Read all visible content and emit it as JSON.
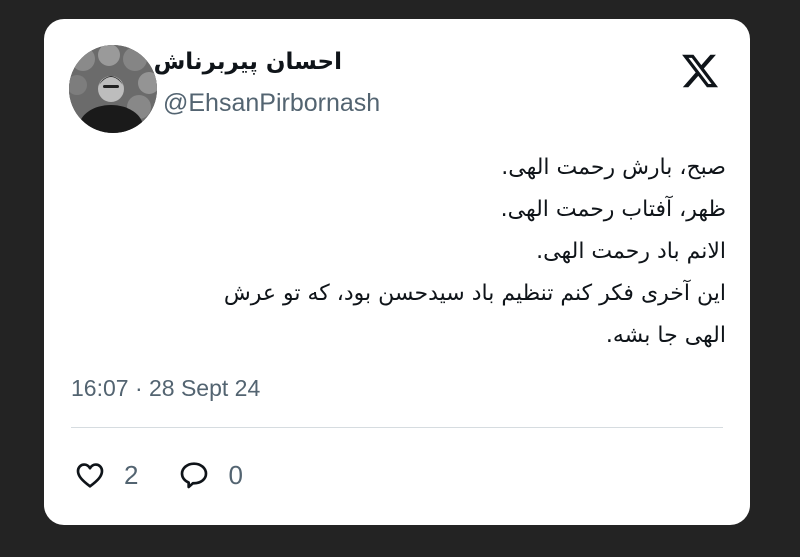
{
  "tweet": {
    "author": {
      "display_name": "احسان پیربرناش",
      "handle": "@EhsanPirbornash",
      "avatar_icon": "profile-photo"
    },
    "platform_icon": "x-logo-icon",
    "lines": [
      "صبح، بارش رحمت الهی.",
      "ظهر، آفتاب رحمت الهی.",
      "الانم باد رحمت الهی.",
      "این آخری فکر کنم تنظیم باد سیدحسن بود، که تو عرش",
      "الهی جا بشه."
    ],
    "timestamp": "16:07 · 28 Sept 24",
    "likes": "2",
    "replies": "0"
  },
  "colors": {
    "background": "#232323",
    "card": "#ffffff",
    "text": "#0f1419",
    "secondary": "#536471"
  }
}
